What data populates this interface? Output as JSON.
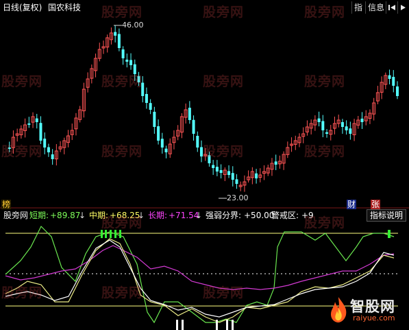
{
  "header": {
    "period_label": "日线(复权)",
    "stock_name": "国农科技",
    "buttons": [
      "指",
      "信息"
    ],
    "nav_icons": [
      "step-back-icon",
      "scroll-right-icon"
    ]
  },
  "watermark_text": "股旁网",
  "price_chart": {
    "high_label": "46.00",
    "low_label": "23.00",
    "up_color": "#ff5555",
    "down_color": "#54ffff"
  },
  "markers": {
    "left": "榜",
    "right1": "财",
    "right2": "张"
  },
  "indicator": {
    "source": "股旁网",
    "short": {
      "label": "短期:",
      "value": "+89.87",
      "arrow": "↓",
      "color": "#7fff5a"
    },
    "mid": {
      "label": "中期:",
      "value": "+68.25",
      "arrow": "↓",
      "color": "#ffff66"
    },
    "long": {
      "label": "长期:",
      "value": "+71.54",
      "arrow": "↓",
      "color": "#ff44ff"
    },
    "strong": {
      "label": "强弱分界:",
      "value": "+50.00",
      "color": "#ffffff"
    },
    "warn": {
      "label": "警戒区:",
      "value": "+9",
      "color": "#ffffff"
    },
    "explain_button": "指标说明"
  },
  "brand": {
    "name": "智股网",
    "url": "raiyue.com"
  }
}
